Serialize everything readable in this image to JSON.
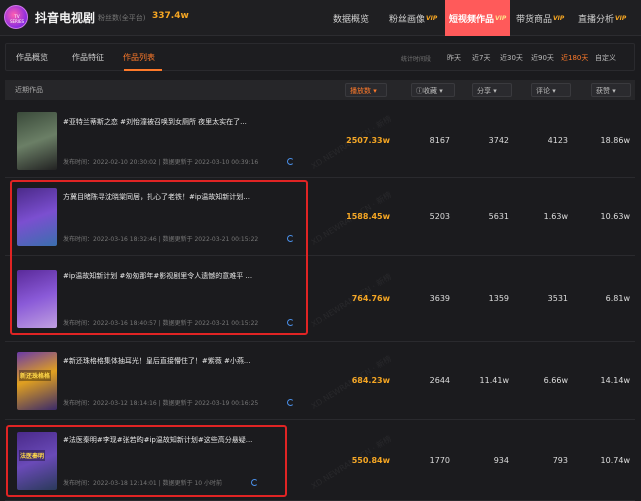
{
  "header": {
    "logo_text": "TV SERIES",
    "brand": "抖音电视剧",
    "fans_label": "粉丝数(全平台)",
    "fans_value": "337.4w"
  },
  "nav": [
    {
      "label": "数据概览",
      "vip": ""
    },
    {
      "label": "粉丝画像",
      "vip": "VIP"
    },
    {
      "label": "短视频作品",
      "vip": "VIP"
    },
    {
      "label": "带货商品",
      "vip": "VIP"
    },
    {
      "label": "直播分析",
      "vip": "VIP"
    }
  ],
  "subtabs": [
    "作品概览",
    "作品特征",
    "作品列表"
  ],
  "range": {
    "label": "统计时间段",
    "options": [
      "昨天",
      "近7天",
      "近30天",
      "近90天",
      "近180天",
      "自定义"
    ],
    "active": "近180天"
  },
  "table": {
    "columns": {
      "works": "近期作品",
      "plays": "播放数",
      "favorites": "收藏",
      "shares": "分享",
      "comments": "评论",
      "likes": "获赞"
    },
    "rows": [
      {
        "title": "#亚特兰蒂斯之恋 #刘怡潼被召唤到女厕所 夜里太实在了...",
        "published": "发布时间：2022-02-10 20:30:02",
        "updated": "数据更新于 2022-03-10 00:39:16",
        "plays": "2507.33w",
        "favorites": "8167",
        "shares": "3742",
        "comments": "4123",
        "likes": "18.86w"
      },
      {
        "title": "方冀目睹陈寻沈晓棠同居，扎心了老铁！#ip温故知新计划...",
        "published": "发布时间：2022-03-16 18:32:46",
        "updated": "数据更新于 2022-03-21 00:15:22",
        "plays": "1588.45w",
        "favorites": "5203",
        "shares": "5631",
        "comments": "1.63w",
        "likes": "10.63w"
      },
      {
        "title": "#ip温故知新计划 #匆匆那年#影视剧里令人遗憾的意难平 ...",
        "published": "发布时间：2022-03-16 18:40:57",
        "updated": "数据更新于 2022-03-21 00:15:22",
        "plays": "764.76w",
        "favorites": "3639",
        "shares": "1359",
        "comments": "3531",
        "likes": "6.81w"
      },
      {
        "title": "#新还珠格格集体抽耳光！皇后直接懵住了！#紫薇 #小燕...",
        "published": "发布时间：2022-03-12 18:14:16",
        "updated": "数据更新于 2022-03-19 00:16:25",
        "plays": "684.23w",
        "favorites": "2644",
        "shares": "11.41w",
        "comments": "6.66w",
        "likes": "14.14w"
      },
      {
        "title": "#法医秦明#李现#张若昀#ip温故知新计划#这些高分悬疑...",
        "published": "发布时间：2022-03-18 12:14:01",
        "updated": "数据更新于 10 小时前",
        "plays": "550.84w",
        "favorites": "1770",
        "shares": "934",
        "comments": "793",
        "likes": "10.74w"
      }
    ]
  },
  "thumb_labels": [
    "",
    "",
    "",
    "新还珠格格",
    "法医秦明"
  ],
  "watermark": "XD.NEWRANK.CN · 新榜",
  "colors": {
    "accent": "#ff7a2a",
    "active_nav": "#ff5a5a",
    "highlight_box": "#e02424",
    "plays": "#f5a623"
  }
}
